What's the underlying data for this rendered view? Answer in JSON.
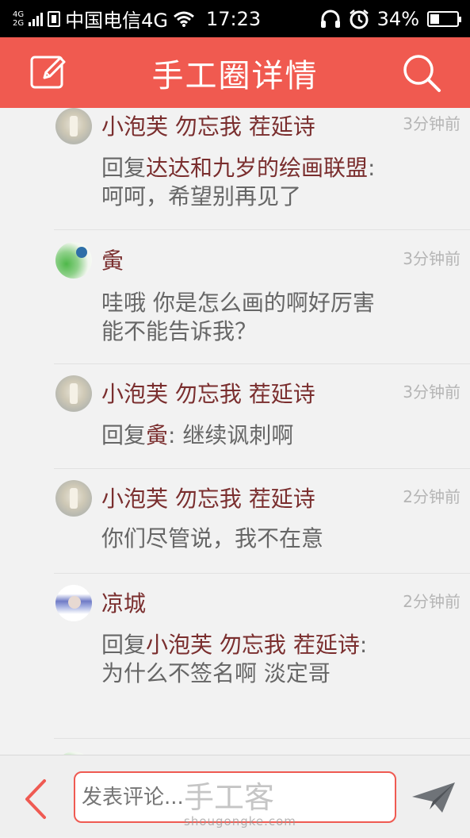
{
  "status_bar": {
    "network_top": "4G",
    "network_bottom": "2G",
    "carrier": "中国电信4G",
    "time": "17:23",
    "battery_percent": "34%",
    "battery_level": 0.34
  },
  "header": {
    "title": "手工圈详情",
    "edit_icon": "edit-icon",
    "search_icon": "search-icon"
  },
  "comments": [
    {
      "user": "小泡芙  勿忘我 茬延诗",
      "time": "3分钟前",
      "reply_prefix": "回复",
      "reply_to": "达达和九岁的绘画联盟",
      "text": ": 呵呵，希望别再见了"
    },
    {
      "user": "夤",
      "time": "3分钟前",
      "reply_prefix": "",
      "reply_to": "",
      "text": "哇哦 你是怎么画的啊好厉害能不能告诉我？"
    },
    {
      "user": "小泡芙  勿忘我 茬延诗",
      "time": "3分钟前",
      "reply_prefix": "回复",
      "reply_to": "夤",
      "text": ": 继续讽刺啊"
    },
    {
      "user": "小泡芙  勿忘我 茬延诗",
      "time": "2分钟前",
      "reply_prefix": "",
      "reply_to": "",
      "text": "你们尽管说，我不在意"
    },
    {
      "user": "凉城",
      "time": "2分钟前",
      "reply_prefix": "回复",
      "reply_to": "小泡芙  勿忘我 茬延诗",
      "text": ": 为什么不签名啊 淡定哥"
    }
  ],
  "bottom_bar": {
    "input_placeholder": "发表评论...",
    "watermark_main": "手工客",
    "watermark_sub": "shougongke.com",
    "back_icon": "chevron-left-icon",
    "send_icon": "send-icon"
  },
  "colors": {
    "accent": "#f05a50",
    "username": "#7a2e2e",
    "body_text": "#666666",
    "timestamp": "#b5b5b5"
  }
}
